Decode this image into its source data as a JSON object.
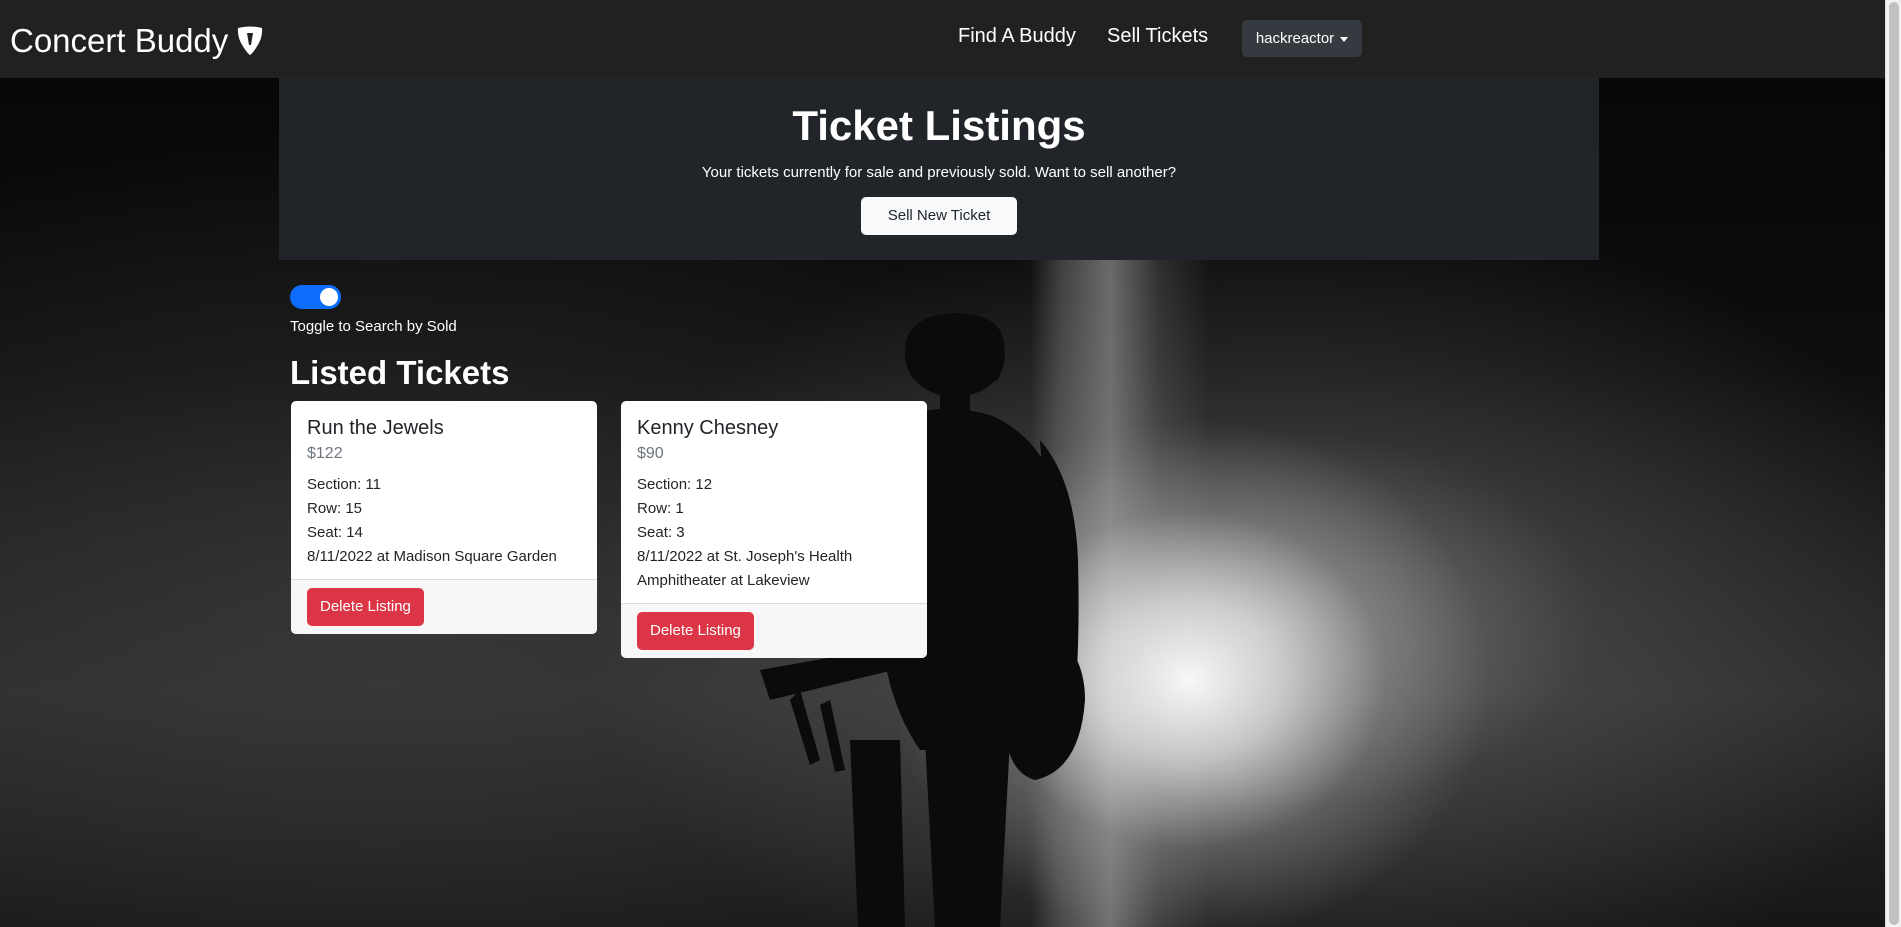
{
  "navbar": {
    "brand": "Concert Buddy",
    "links": [
      {
        "label": "Find A Buddy"
      },
      {
        "label": "Sell Tickets"
      }
    ],
    "user": "hackreactor"
  },
  "header": {
    "title": "Ticket Listings",
    "subtitle": "Your tickets currently for sale and previously sold. Want to sell another?",
    "button": "Sell New Ticket"
  },
  "toggle": {
    "label": "Toggle to Search by Sold",
    "on": true
  },
  "section_title": "Listed Tickets",
  "tickets": [
    {
      "artist": "Run the Jewels",
      "price": "$122",
      "section": "Section: 11",
      "row": "Row: 15",
      "seat": "Seat: 14",
      "event": "8/11/2022 at Madison Square Garden",
      "action": "Delete Listing"
    },
    {
      "artist": "Kenny Chesney",
      "price": "$90",
      "section": "Section: 12",
      "row": "Row: 1",
      "seat": "Seat: 3",
      "event": "8/11/2022 at St. Joseph's Health Amphitheater at Lakeview",
      "action": "Delete Listing"
    }
  ],
  "colors": {
    "navbar": "#212121",
    "panel": "#212529",
    "toggle": "#0d6efd",
    "danger": "#dc3545"
  }
}
